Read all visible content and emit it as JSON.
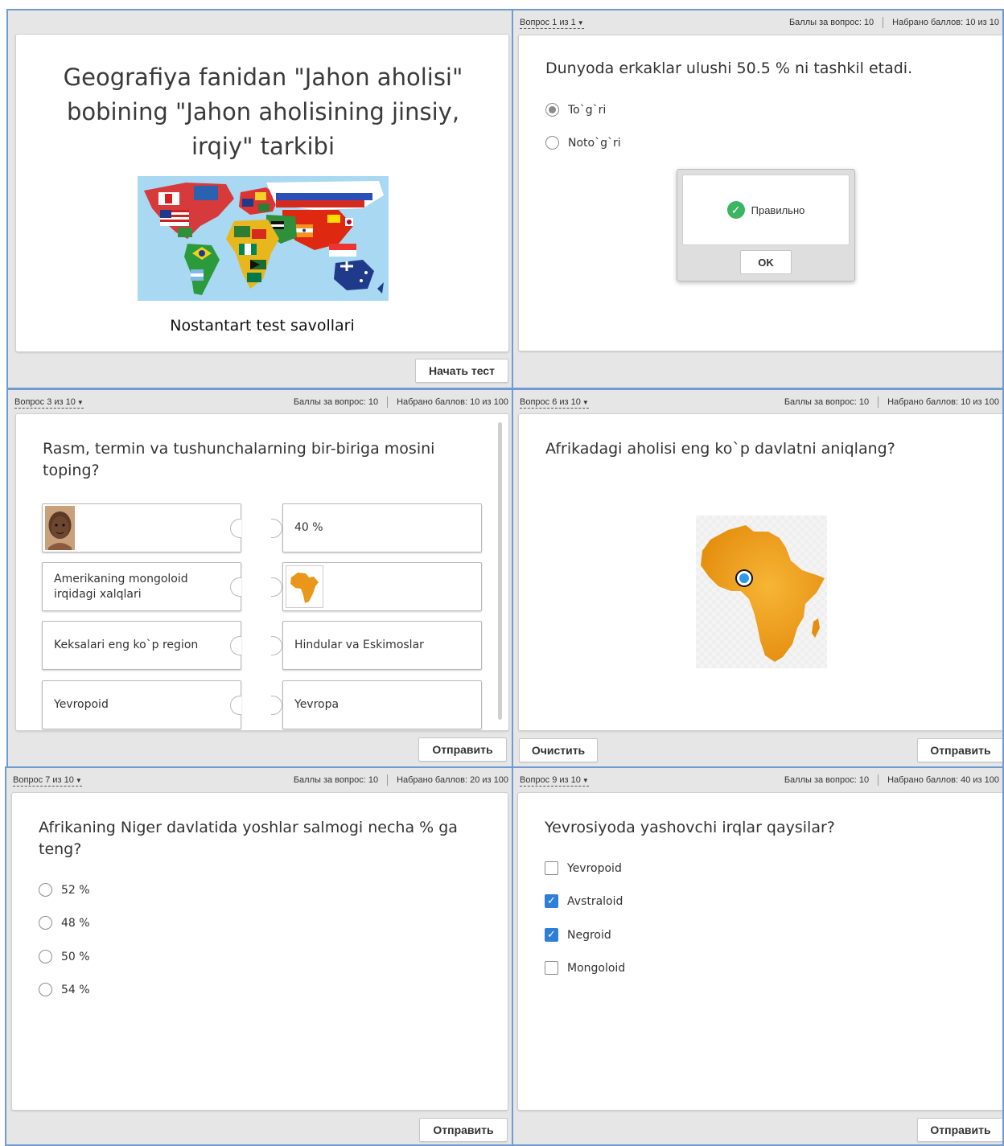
{
  "intro": {
    "title": "Geografiya fanidan \"Jahon aholisi\" bobining \"Jahon aholisining jinsiy, irqiy\" tarkibi",
    "subtitle": "Nostantart test savollari",
    "start_button": "Начать тест"
  },
  "q1": {
    "nav": "Вопрос 1 из 1",
    "points": "Баллы за вопрос: 10",
    "score": "Набрано баллов: 10 из 10",
    "question": "Dunyoda erkaklar ulushi 50.5 % ni tashkil etadi.",
    "options": [
      "To`g`ri",
      "Noto`g`ri"
    ],
    "selected": 0,
    "feedback": "Правильно",
    "ok_button": "OK"
  },
  "q3": {
    "nav": "Вопрос 3 из 10",
    "points": "Баллы за вопрос: 10",
    "score": "Набрано баллов: 10 из 100",
    "question": "Rasm, termin va tushunchalarning bir-biriga mosini toping?",
    "left_items": [
      "",
      "Amerikaning mongoloid irqidagi xalqlari",
      "Keksalari eng ko`p region",
      "Yevropoid"
    ],
    "right_items": [
      "40 %",
      "",
      "Hindular va Eskimoslar",
      "Yevropa"
    ],
    "submit_button": "Отправить"
  },
  "q6": {
    "nav": "Вопрос 6 из 10",
    "points": "Баллы за вопрос: 10",
    "score": "Набрано баллов: 10 из 100",
    "question": "Afrikadagi aholisi eng ko`p davlatni aniqlang?",
    "clear_button": "Очистить",
    "submit_button": "Отправить"
  },
  "q7": {
    "nav": "Вопрос 7 из 10",
    "points": "Баллы за вопрос: 10",
    "score": "Набрано баллов: 20 из 100",
    "question": "Afrikaning Niger davlatida yoshlar salmogi necha % ga teng?",
    "options": [
      "52 %",
      "48 %",
      "50 %",
      "54 %"
    ],
    "submit_button": "Отправить"
  },
  "q9": {
    "nav": "Вопрос 9 из 10",
    "points": "Баллы за вопрос: 10",
    "score": "Набрано баллов: 40 из 100",
    "question": "Yevrosiyoda yashovchi irqlar qaysilar?",
    "options": [
      {
        "label": "Yevropoid",
        "checked": false
      },
      {
        "label": "Avstraloid",
        "checked": true
      },
      {
        "label": "Negroid",
        "checked": true
      },
      {
        "label": "Mongoloid",
        "checked": false
      }
    ],
    "submit_button": "Отправить"
  },
  "colors": {
    "panel_border": "#6f9bd1",
    "panel_bg": "#e6e6e6",
    "checkbox_checked": "#2f7fd8",
    "correct_green": "#3cb563",
    "map_ocean": "#a9d8f2",
    "africa_orange": "#f0a020",
    "marker_blue": "#2e9be6"
  }
}
